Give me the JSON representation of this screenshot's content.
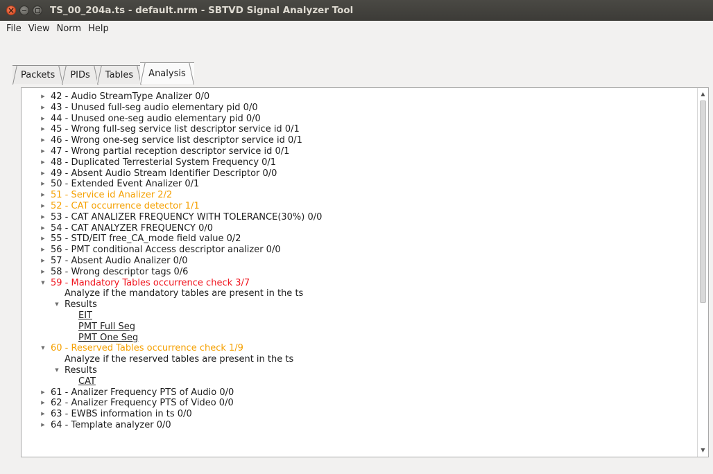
{
  "window": {
    "title": "TS_00_204a.ts - default.nrm - SBTVD Signal Analyzer Tool"
  },
  "menu": [
    "File",
    "View",
    "Norm",
    "Help"
  ],
  "tabs": [
    {
      "label": "Packets",
      "active": false
    },
    {
      "label": "PIDs",
      "active": false
    },
    {
      "label": "Tables",
      "active": false
    },
    {
      "label": "Analysis",
      "active": true
    }
  ],
  "colors": {
    "warning": "#f5a000",
    "error": "#f0141e",
    "normal": "#1e1e1e"
  },
  "icons": {
    "collapsed": "triangle-right",
    "expanded": "triangle-down"
  },
  "tree": [
    {
      "text": "42 - Audio StreamType Analizer  0/0"
    },
    {
      "text": "43 - Unused full-seg audio elementary pid  0/0"
    },
    {
      "text": "44 - Unused one-seg audio elementary pid  0/0"
    },
    {
      "text": "45 - Wrong full-seg service list descriptor service id  0/1"
    },
    {
      "text": "46 - Wrong one-seg service list descriptor service id  0/1"
    },
    {
      "text": "47 - Wrong partial reception descriptor service id  0/1"
    },
    {
      "text": "48 - Duplicated Terresterial System Frequency  0/1"
    },
    {
      "text": "49 - Absent Audio Stream Identifier Descriptor  0/0"
    },
    {
      "text": "50 - Extended Event Analizer  0/1"
    },
    {
      "text": "51 - Service id Analizer  2/2"
    },
    {
      "text": "52 - CAT occurrence detector  1/1"
    },
    {
      "text": "53 - CAT ANALIZER FREQUENCY WITH TOLERANCE(30%)  0/0"
    },
    {
      "text": "54 - CAT ANALYZER FREQUENCY  0/0"
    },
    {
      "text": "55 - STD/EIT free_CA_mode field value  0/2"
    },
    {
      "text": "56 - PMT conditional Access descriptor analizer  0/0"
    },
    {
      "text": "57 - Absent Audio Analizer  0/0"
    },
    {
      "text": "58 - Wrong descriptor tags  0/6"
    },
    {
      "text": "59 - Mandatory Tables occurrence check  3/7"
    },
    {
      "text": "Analyze if the mandatory tables are present in the ts"
    },
    {
      "text": "Results"
    },
    {
      "text": "EIT"
    },
    {
      "text": "PMT Full Seg"
    },
    {
      "text": "PMT One Seg"
    },
    {
      "text": "60 - Reserved Tables occurrence check  1/9"
    },
    {
      "text": "Analyze if the reserved tables are present in the ts"
    },
    {
      "text": "Results"
    },
    {
      "text": "CAT"
    },
    {
      "text": "61 -  Analizer Frequency PTS of Audio  0/0"
    },
    {
      "text": "62 -  Analizer Frequency PTS of Video  0/0"
    },
    {
      "text": "63 - EWBS information in ts  0/0"
    },
    {
      "text": "64 - Template analyzer  0/0"
    }
  ]
}
